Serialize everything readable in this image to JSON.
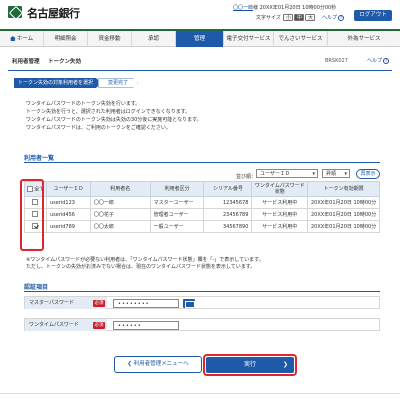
{
  "header": {
    "bank_name": "名古屋銀行",
    "user_name": "〇〇一郎",
    "user_suffix": "様",
    "last_login": "20XX年01月20日 10時00分00秒",
    "font_size_label": "文字サイズ",
    "font_small": "小",
    "font_medium": "中",
    "font_large": "大",
    "help": "ヘルプ",
    "logout": "ログアウト"
  },
  "nav": {
    "items": [
      {
        "label": "ホーム",
        "icon": "home-icon"
      },
      {
        "label": "明細照会"
      },
      {
        "label": "資金移動"
      },
      {
        "label": "承認"
      },
      {
        "label": "管理"
      },
      {
        "label": "電子交付サービス"
      },
      {
        "label": "でんさいサービス"
      },
      {
        "label": "外為サービス"
      }
    ],
    "active_index": 4
  },
  "page": {
    "crumb": "利用者管理",
    "title": "トークン失効",
    "screen_id": "BRSK027",
    "help": "ヘルプ",
    "help_icon": "?"
  },
  "steps": [
    "トークン失効の対象利用者を選択",
    "変更完了"
  ],
  "description": [
    "ワンタイムパスワードのトークン失効を行います。",
    "トークン失効を行うと、選択された利用者はログインできなくなります。",
    "ワンタイムパスワードのトークン失効は失効の30分後に実施可能となります。",
    "ワンタイムパスワードは、ご利用のトークンをご確認ください。"
  ],
  "user_list": {
    "section_title": "利用者一覧",
    "sort_label": "並び順：",
    "sort_value": "ユーザーＩＤ",
    "order_value": "昇順",
    "rearrange_button": "再表示",
    "headers": [
      "全て",
      "ユーザーＩＤ",
      "利用者名",
      "利用者区分",
      "シリアル番号",
      "ワンタイムパスワード状態",
      "トークン有効期限"
    ],
    "rows": [
      {
        "checked": false,
        "user_id": "userid123",
        "name": "〇〇一郎",
        "type": "マスターユーザー",
        "serial": "12345678",
        "status": "サービス利用中",
        "expiry": "20XX年01月20日 10時00分"
      },
      {
        "checked": false,
        "user_id": "userid456",
        "name": "〇〇花子",
        "type": "管理者ユーザー",
        "serial": "23456789",
        "status": "サービス利用中",
        "expiry": "20XX年01月20日 10時00分"
      },
      {
        "checked": true,
        "user_id": "userid789",
        "name": "〇〇太郎",
        "type": "一般ユーザー",
        "serial": "34567890",
        "status": "サービス利用中",
        "expiry": "20XX年01月20日 10時00分"
      }
    ]
  },
  "notes": [
    "※ワンタイムパスワードが必要ない利用者は、「ワンタイムパスワード状態」欄を「-」で表示しています。",
    "ただし、トークンの失効がお済みでない場合は、現在のワンタイムパスワード状態を表示しています。"
  ],
  "auth": {
    "section_title": "認証項目",
    "required": "必須",
    "master_label": "マスターパスワード",
    "master_value": "••••••••",
    "onetime_label": "ワンタイムパスワード",
    "onetime_value": "••••••"
  },
  "buttons": {
    "back": "利用者管理メニューへ",
    "execute": "実行"
  },
  "colors": {
    "brand_green": "#1f6b3a",
    "primary_blue": "#1e5aa8",
    "highlight_red": "#e0262b",
    "required_red": "#c91f2c"
  }
}
